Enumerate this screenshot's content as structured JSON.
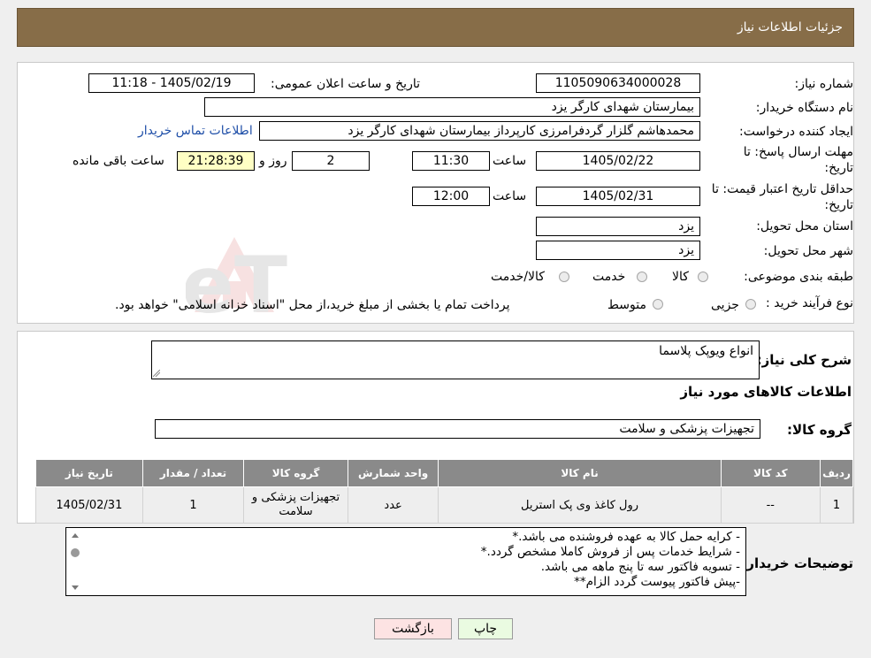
{
  "header": {
    "title": "جزئیات اطلاعات نیاز"
  },
  "info": {
    "need_number_label": "شماره نیاز:",
    "need_number": "1105090634000028",
    "announce_label": "تاریخ و ساعت اعلان عمومی:",
    "announce_value": "1405/02/19 - 11:18",
    "buyer_org_label": "نام دستگاه خریدار:",
    "buyer_org": "بیمارستان شهدای کارگر یزد",
    "requester_label": "ایجاد کننده درخواست:",
    "requester": "محمدهاشم گلزار گردفرامرزی کارپرداز بیمارستان شهدای کارگر یزد",
    "contact_link": "اطلاعات تماس خریدار",
    "deadline_label_1": "مهلت ارسال پاسخ: تا",
    "deadline_label_2": "تاریخ:",
    "deadline_date": "1405/02/22",
    "time_label": "ساعت",
    "deadline_time": "11:30",
    "days": "2",
    "days_label": "روز و",
    "remaining": "21:28:39",
    "remaining_label": "ساعت باقی مانده",
    "validity_label_1": "حداقل تاریخ اعتبار قیمت: تا",
    "validity_label_2": "تاریخ:",
    "validity_date": "1405/02/31",
    "validity_time_label": "ساعت",
    "validity_time": "12:00",
    "province_label": "استان محل تحویل:",
    "province": "یزد",
    "city_label": "شهر محل تحویل:",
    "city": "یزد",
    "category_label": "طبقه بندی موضوعی:",
    "category_options": [
      "کالا",
      "خدمت",
      "کالا/خدمت"
    ],
    "process_label": "نوع فرآیند خرید :",
    "process_options": [
      "جزیی",
      "متوسط"
    ],
    "process_note": "پرداخت تمام یا بخشی از مبلغ خرید،از محل \"اسناد خزانه اسلامی\" خواهد بود."
  },
  "detail": {
    "summary_label": "شرح کلی نیاز:",
    "summary": "انواع ویوپک پلاسما",
    "goods_info_title": "اطلاعات کالاهای مورد نیاز",
    "group_label": "گروه کالا:",
    "group": "تجهیزات پزشکی و سلامت",
    "columns": [
      "ردیف",
      "کد کالا",
      "نام کالا",
      "واحد شمارش",
      "گروه کالا",
      "تعداد / مقدار",
      "تاریخ نیاز"
    ],
    "rows": [
      [
        "1",
        "--",
        "رول کاغذ وی پک استریل",
        "عدد",
        "تجهیزات پزشکی و سلامت",
        "1",
        "1405/02/31"
      ]
    ],
    "notes_label": "توضیحات خریدار:",
    "notes": [
      "- کرایه حمل  کالا به عهده فروشنده می باشد.*",
      "- شرایط خدمات پس از فروش کاملا مشخص گردد.*",
      "- تسویه فاکتور سه تا پنج ماهه می باشد.",
      "-پیش فاکتور پیوست گردد  الزام**"
    ]
  },
  "buttons": {
    "print": "چاپ",
    "back": "بازگشت"
  },
  "watermark": "AriaTender.neT"
}
